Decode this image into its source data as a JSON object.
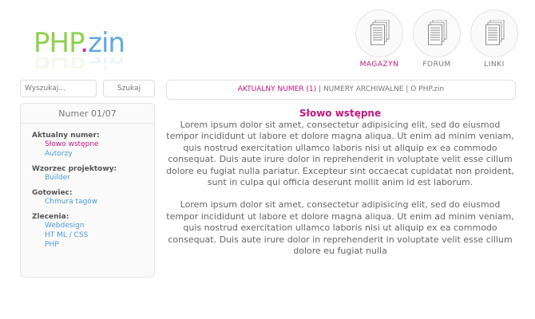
{
  "logo": {
    "part1": "PHP",
    "dot": ".",
    "part2": "zin"
  },
  "nav": [
    {
      "label": "MAGAZYN",
      "active": true
    },
    {
      "label": "FORUM",
      "active": false
    },
    {
      "label": "LINKI",
      "active": false
    }
  ],
  "search": {
    "placeholder": "Wyszukaj...",
    "button": "Szukaj"
  },
  "topbar": {
    "current": "AKTUALNY NUMER (1)",
    "separator": "|",
    "archive": "NUMERY ARCHIWALNE",
    "about": "O PHP.zin"
  },
  "sidebar": {
    "title": "Numer 01/07",
    "sections": [
      {
        "head": "Aktualny numer:",
        "items": [
          "Słowo wstępne",
          "Autorzy"
        ]
      },
      {
        "head": "Wzorzec projektowy:",
        "items": [
          "Builder"
        ]
      },
      {
        "head": "Gotowiec:",
        "items": [
          "Chmura tagów"
        ]
      },
      {
        "head": "Zlecenia:",
        "items": [
          "Webdesign",
          "HT ML / CSS",
          "PHP"
        ]
      }
    ]
  },
  "article": {
    "title": "Słowo wstępne",
    "p1": "Lorem ipsum dolor sit amet, consectetur adipisicing elit, sed do eiusmod tempor incididunt ut labore et dolore magna aliqua. Ut enim ad minim veniam, quis nostrud exercitation ullamco laboris nisi ut aliquip ex ea commodo consequat. Duis aute irure dolor in reprehenderit in voluptate velit esse cillum dolore eu fugiat nulla pariatur. Excepteur sint occaecat cupidatat non proident, sunt in culpa qui officia deserunt mollit anim id est laborum.",
    "p2": "Lorem ipsum dolor sit amet, consectetur adipisicing elit, sed do eiusmod tempor incididunt ut labore et dolore magna aliqua. Ut enim ad minim veniam, quis nostrud exercitation ullamco laboris nisi ut aliquip ex ea commodo consequat. Duis aute irure dolor in reprehenderit in voluptate velit esse cillum dolore eu fugiat nulla"
  },
  "colors": {
    "accent": "#c2187e",
    "link": "#4a9ad6",
    "logo_green": "#8fd14f",
    "logo_blue": "#5fa8e6"
  },
  "icons": {
    "nav": "document-icon"
  }
}
